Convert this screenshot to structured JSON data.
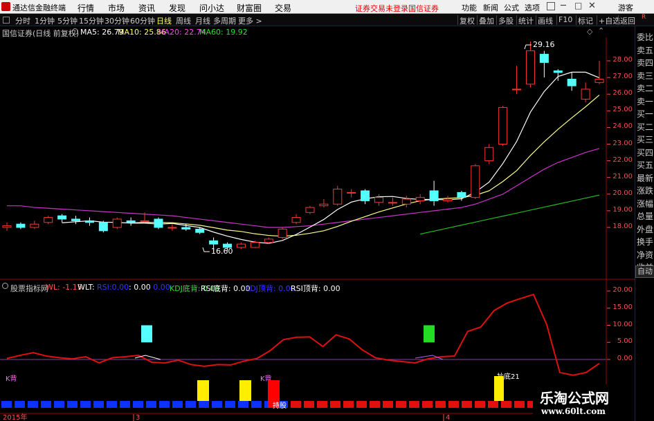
{
  "app": {
    "title": "通达信金融终端"
  },
  "menu": {
    "items": [
      "行情",
      "市场",
      "资讯",
      "发现",
      "问小达",
      "财富圈",
      "交易"
    ],
    "status_login": "证券交易未登录",
    "broker": "国信证券",
    "right_items": [
      "功能",
      "新闻",
      "公式",
      "选项"
    ],
    "theme": "游客"
  },
  "toolbar": {
    "periods": [
      "分时",
      "1分钟",
      "5分钟",
      "15分钟",
      "30分钟",
      "60分钟",
      "日线",
      "周线",
      "月线",
      "多周期",
      "更多 >"
    ],
    "selected": "日线",
    "right_buttons": [
      "复权",
      "叠加",
      "多股",
      "统计",
      "画线",
      "F10",
      "标记",
      "+自选",
      "返回"
    ]
  },
  "stock": {
    "name": "国信证券(日线 前复权)",
    "ma": [
      {
        "label": "MA5: 26.79",
        "color": "#ffffff"
      },
      {
        "label": "MA10: 25.86",
        "color": "#ffff66"
      },
      {
        "label": "MA20: 22.74",
        "color": "#ff44ff"
      },
      {
        "label": "MA60: 19.92",
        "color": "#33dd33"
      }
    ],
    "high_label": "29.16",
    "low_label": "16.60"
  },
  "price_axis": [
    "28.00",
    "27.00",
    "26.00",
    "25.00",
    "24.00",
    "23.00",
    "22.00",
    "21.00",
    "20.00",
    "19.00",
    "18.00"
  ],
  "indicator": {
    "name": "股票指标网",
    "items": [
      {
        "label": "WL: -1.15",
        "color": "#ff5555"
      },
      {
        "label": "WLT:",
        "color": "#ffffff"
      },
      {
        "label": "RSI:0.00",
        "color": "#3333ff"
      },
      {
        "label": ": 0.00",
        "color": "#ffffff"
      },
      {
        "label": ": 0.00",
        "color": "#3333ff"
      },
      {
        "label": "KDJ底背: 0.00",
        "color": "#33dd33"
      },
      {
        "label": "RSI底背: 0.00",
        "color": "#ffffff"
      },
      {
        "label": "KDJ顶背: 0.00",
        "color": "#3333ff"
      },
      {
        "label": "RSI顶背: 0.00",
        "color": "#ffffff"
      }
    ],
    "axis": [
      "20.00",
      "15.00",
      "10.00",
      "5.00",
      "0.00"
    ],
    "labels": {
      "kbei": "K背",
      "kbei2": "K背",
      "hold": "持股",
      "bottom": "抄底21"
    }
  },
  "sidebar": {
    "items": [
      "委比",
      "卖五",
      "卖四",
      "卖三",
      "卖二",
      "卖一",
      "买一",
      "买二",
      "买三",
      "买四",
      "买五",
      "最新",
      "涨跌",
      "涨幅",
      "总量",
      "外盘",
      "换手",
      "净资",
      "收益"
    ],
    "bottom": "自动",
    "corner": "R"
  },
  "dates": {
    "start": "2015年",
    "mid": "3",
    "end": "4"
  },
  "watermark": {
    "line1": "乐淘公式网",
    "line2": "www.60lt.com"
  }
}
